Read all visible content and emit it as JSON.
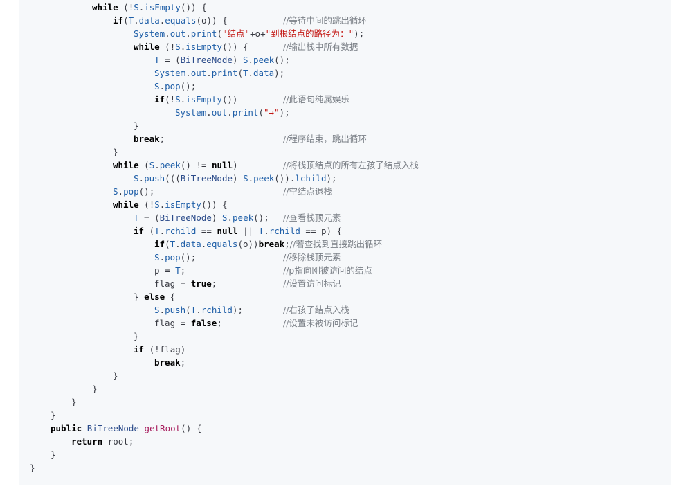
{
  "code_lines": [
    {
      "indent": 6,
      "tokens": [
        [
          "kw",
          "while"
        ],
        [
          "txt",
          " (!"
        ],
        [
          "id",
          "S"
        ],
        [
          "txt",
          "."
        ],
        [
          "id",
          "isEmpty"
        ],
        [
          "txt",
          "()) {"
        ]
      ]
    },
    {
      "indent": 8,
      "tokens": [
        [
          "kw",
          "if"
        ],
        [
          "txt",
          "("
        ],
        [
          "id",
          "T"
        ],
        [
          "txt",
          "."
        ],
        [
          "id",
          "data"
        ],
        [
          "txt",
          "."
        ],
        [
          "id",
          "equals"
        ],
        [
          "txt",
          "(o)) {"
        ]
      ],
      "comment": "//等待中间的跳出循环"
    },
    {
      "indent": 10,
      "tokens": [
        [
          "id",
          "System"
        ],
        [
          "txt",
          "."
        ],
        [
          "id",
          "out"
        ],
        [
          "txt",
          "."
        ],
        [
          "id",
          "print"
        ],
        [
          "txt",
          "("
        ],
        [
          "str",
          "\"结点\""
        ],
        [
          "txt",
          "+o+"
        ],
        [
          "str",
          "\"到根结点的路径为：\""
        ],
        [
          "txt",
          ");"
        ]
      ]
    },
    {
      "indent": 10,
      "tokens": [
        [
          "kw",
          "while"
        ],
        [
          "txt",
          " (!"
        ],
        [
          "id",
          "S"
        ],
        [
          "txt",
          "."
        ],
        [
          "id",
          "isEmpty"
        ],
        [
          "txt",
          "()) {"
        ]
      ],
      "comment": "//输出栈中所有数据"
    },
    {
      "indent": 12,
      "tokens": [
        [
          "id",
          "T"
        ],
        [
          "txt",
          " = ("
        ],
        [
          "ty",
          "BiTreeNode"
        ],
        [
          "txt",
          ") "
        ],
        [
          "id",
          "S"
        ],
        [
          "txt",
          "."
        ],
        [
          "id",
          "peek"
        ],
        [
          "txt",
          "();"
        ]
      ]
    },
    {
      "indent": 12,
      "tokens": [
        [
          "id",
          "System"
        ],
        [
          "txt",
          "."
        ],
        [
          "id",
          "out"
        ],
        [
          "txt",
          "."
        ],
        [
          "id",
          "print"
        ],
        [
          "txt",
          "("
        ],
        [
          "id",
          "T"
        ],
        [
          "txt",
          "."
        ],
        [
          "id",
          "data"
        ],
        [
          "txt",
          ");"
        ]
      ]
    },
    {
      "indent": 12,
      "tokens": [
        [
          "id",
          "S"
        ],
        [
          "txt",
          "."
        ],
        [
          "id",
          "pop"
        ],
        [
          "txt",
          "();"
        ]
      ]
    },
    {
      "indent": 12,
      "tokens": [
        [
          "kw",
          "if"
        ],
        [
          "txt",
          "(!"
        ],
        [
          "id",
          "S"
        ],
        [
          "txt",
          "."
        ],
        [
          "id",
          "isEmpty"
        ],
        [
          "txt",
          "())"
        ]
      ],
      "comment": "//此语句纯属娱乐"
    },
    {
      "indent": 14,
      "tokens": [
        [
          "id",
          "System"
        ],
        [
          "txt",
          "."
        ],
        [
          "id",
          "out"
        ],
        [
          "txt",
          "."
        ],
        [
          "id",
          "print"
        ],
        [
          "txt",
          "("
        ],
        [
          "str",
          "\"→\""
        ],
        [
          "txt",
          ");"
        ]
      ]
    },
    {
      "indent": 10,
      "tokens": [
        [
          "txt",
          "}"
        ]
      ]
    },
    {
      "indent": 10,
      "tokens": [
        [
          "kw",
          "break"
        ],
        [
          "txt",
          ";"
        ]
      ],
      "comment": "//程序结束，跳出循环"
    },
    {
      "indent": 8,
      "tokens": [
        [
          "txt",
          "}"
        ]
      ]
    },
    {
      "indent": 8,
      "tokens": [
        [
          "kw",
          "while"
        ],
        [
          "txt",
          " ("
        ],
        [
          "id",
          "S"
        ],
        [
          "txt",
          "."
        ],
        [
          "id",
          "peek"
        ],
        [
          "txt",
          "() != "
        ],
        [
          "kw",
          "null"
        ],
        [
          "txt",
          ")"
        ]
      ],
      "comment": "//将栈顶结点的所有左孩子结点入栈"
    },
    {
      "indent": 10,
      "tokens": [
        [
          "id",
          "S"
        ],
        [
          "txt",
          "."
        ],
        [
          "id",
          "push"
        ],
        [
          "txt",
          "((("
        ],
        [
          "ty",
          "BiTreeNode"
        ],
        [
          "txt",
          ") "
        ],
        [
          "id",
          "S"
        ],
        [
          "txt",
          "."
        ],
        [
          "id",
          "peek"
        ],
        [
          "txt",
          "())."
        ],
        [
          "id",
          "lchild"
        ],
        [
          "txt",
          ");"
        ]
      ]
    },
    {
      "indent": 8,
      "tokens": [
        [
          "id",
          "S"
        ],
        [
          "txt",
          "."
        ],
        [
          "id",
          "pop"
        ],
        [
          "txt",
          "();"
        ]
      ],
      "comment": "//空结点退栈"
    },
    {
      "indent": 8,
      "tokens": [
        [
          "kw",
          "while"
        ],
        [
          "txt",
          " (!"
        ],
        [
          "id",
          "S"
        ],
        [
          "txt",
          "."
        ],
        [
          "id",
          "isEmpty"
        ],
        [
          "txt",
          "()) {"
        ]
      ]
    },
    {
      "indent": 10,
      "tokens": [
        [
          "id",
          "T"
        ],
        [
          "txt",
          " = ("
        ],
        [
          "ty",
          "BiTreeNode"
        ],
        [
          "txt",
          ") "
        ],
        [
          "id",
          "S"
        ],
        [
          "txt",
          "."
        ],
        [
          "id",
          "peek"
        ],
        [
          "txt",
          "();"
        ]
      ],
      "comment": "//查看栈顶元素"
    },
    {
      "indent": 10,
      "tokens": [
        [
          "kw",
          "if"
        ],
        [
          "txt",
          " ("
        ],
        [
          "id",
          "T"
        ],
        [
          "txt",
          "."
        ],
        [
          "id",
          "rchild"
        ],
        [
          "txt",
          " == "
        ],
        [
          "kw",
          "null"
        ],
        [
          "txt",
          " || "
        ],
        [
          "id",
          "T"
        ],
        [
          "txt",
          "."
        ],
        [
          "id",
          "rchild"
        ],
        [
          "txt",
          " == p) {"
        ]
      ]
    },
    {
      "indent": 12,
      "tokens": [
        [
          "kw",
          "if"
        ],
        [
          "txt",
          "("
        ],
        [
          "id",
          "T"
        ],
        [
          "txt",
          "."
        ],
        [
          "id",
          "data"
        ],
        [
          "txt",
          "."
        ],
        [
          "id",
          "equals"
        ],
        [
          "txt",
          "(o))"
        ],
        [
          "kw",
          "break"
        ],
        [
          "txt",
          ";"
        ]
      ],
      "comment": "//若查找到直接跳出循环",
      "comment_inline": true
    },
    {
      "indent": 12,
      "tokens": [
        [
          "id",
          "S"
        ],
        [
          "txt",
          "."
        ],
        [
          "id",
          "pop"
        ],
        [
          "txt",
          "();"
        ]
      ],
      "comment": "//移除栈顶元素"
    },
    {
      "indent": 12,
      "tokens": [
        [
          "txt",
          "p = "
        ],
        [
          "id",
          "T"
        ],
        [
          "txt",
          ";"
        ]
      ],
      "comment": "//p指向刚被访问的结点"
    },
    {
      "indent": 12,
      "tokens": [
        [
          "txt",
          "flag = "
        ],
        [
          "kw",
          "true"
        ],
        [
          "txt",
          ";"
        ]
      ],
      "comment": "//设置访问标记"
    },
    {
      "indent": 10,
      "tokens": [
        [
          "txt",
          "} "
        ],
        [
          "kw",
          "else"
        ],
        [
          "txt",
          " {"
        ]
      ]
    },
    {
      "indent": 12,
      "tokens": [
        [
          "id",
          "S"
        ],
        [
          "txt",
          "."
        ],
        [
          "id",
          "push"
        ],
        [
          "txt",
          "("
        ],
        [
          "id",
          "T"
        ],
        [
          "txt",
          "."
        ],
        [
          "id",
          "rchild"
        ],
        [
          "txt",
          ");"
        ]
      ],
      "comment": "//右孩子结点入栈"
    },
    {
      "indent": 12,
      "tokens": [
        [
          "txt",
          "flag = "
        ],
        [
          "kw",
          "false"
        ],
        [
          "txt",
          ";"
        ]
      ],
      "comment": "//设置未被访问标记"
    },
    {
      "indent": 10,
      "tokens": [
        [
          "txt",
          "}"
        ]
      ]
    },
    {
      "indent": 10,
      "tokens": [
        [
          "kw",
          "if"
        ],
        [
          "txt",
          " (!flag)"
        ]
      ]
    },
    {
      "indent": 12,
      "tokens": [
        [
          "kw",
          "break"
        ],
        [
          "txt",
          ";"
        ]
      ]
    },
    {
      "indent": 8,
      "tokens": [
        [
          "txt",
          "}"
        ]
      ]
    },
    {
      "indent": 6,
      "tokens": [
        [
          "txt",
          "}"
        ]
      ]
    },
    {
      "indent": 4,
      "tokens": [
        [
          "txt",
          "}"
        ]
      ]
    },
    {
      "indent": 2,
      "tokens": [
        [
          "txt",
          "}"
        ]
      ]
    },
    {
      "indent": 2,
      "tokens": [
        [
          "kw",
          "public"
        ],
        [
          "txt",
          " "
        ],
        [
          "ty",
          "BiTreeNode"
        ],
        [
          "txt",
          " "
        ],
        [
          "fn",
          "getRoot"
        ],
        [
          "txt",
          "() {"
        ]
      ]
    },
    {
      "indent": 4,
      "tokens": [
        [
          "kw",
          "return"
        ],
        [
          "txt",
          " root;"
        ]
      ]
    },
    {
      "indent": 2,
      "tokens": [
        [
          "txt",
          "}"
        ]
      ]
    },
    {
      "indent": 0,
      "tokens": [
        [
          "txt",
          "}"
        ]
      ]
    }
  ]
}
